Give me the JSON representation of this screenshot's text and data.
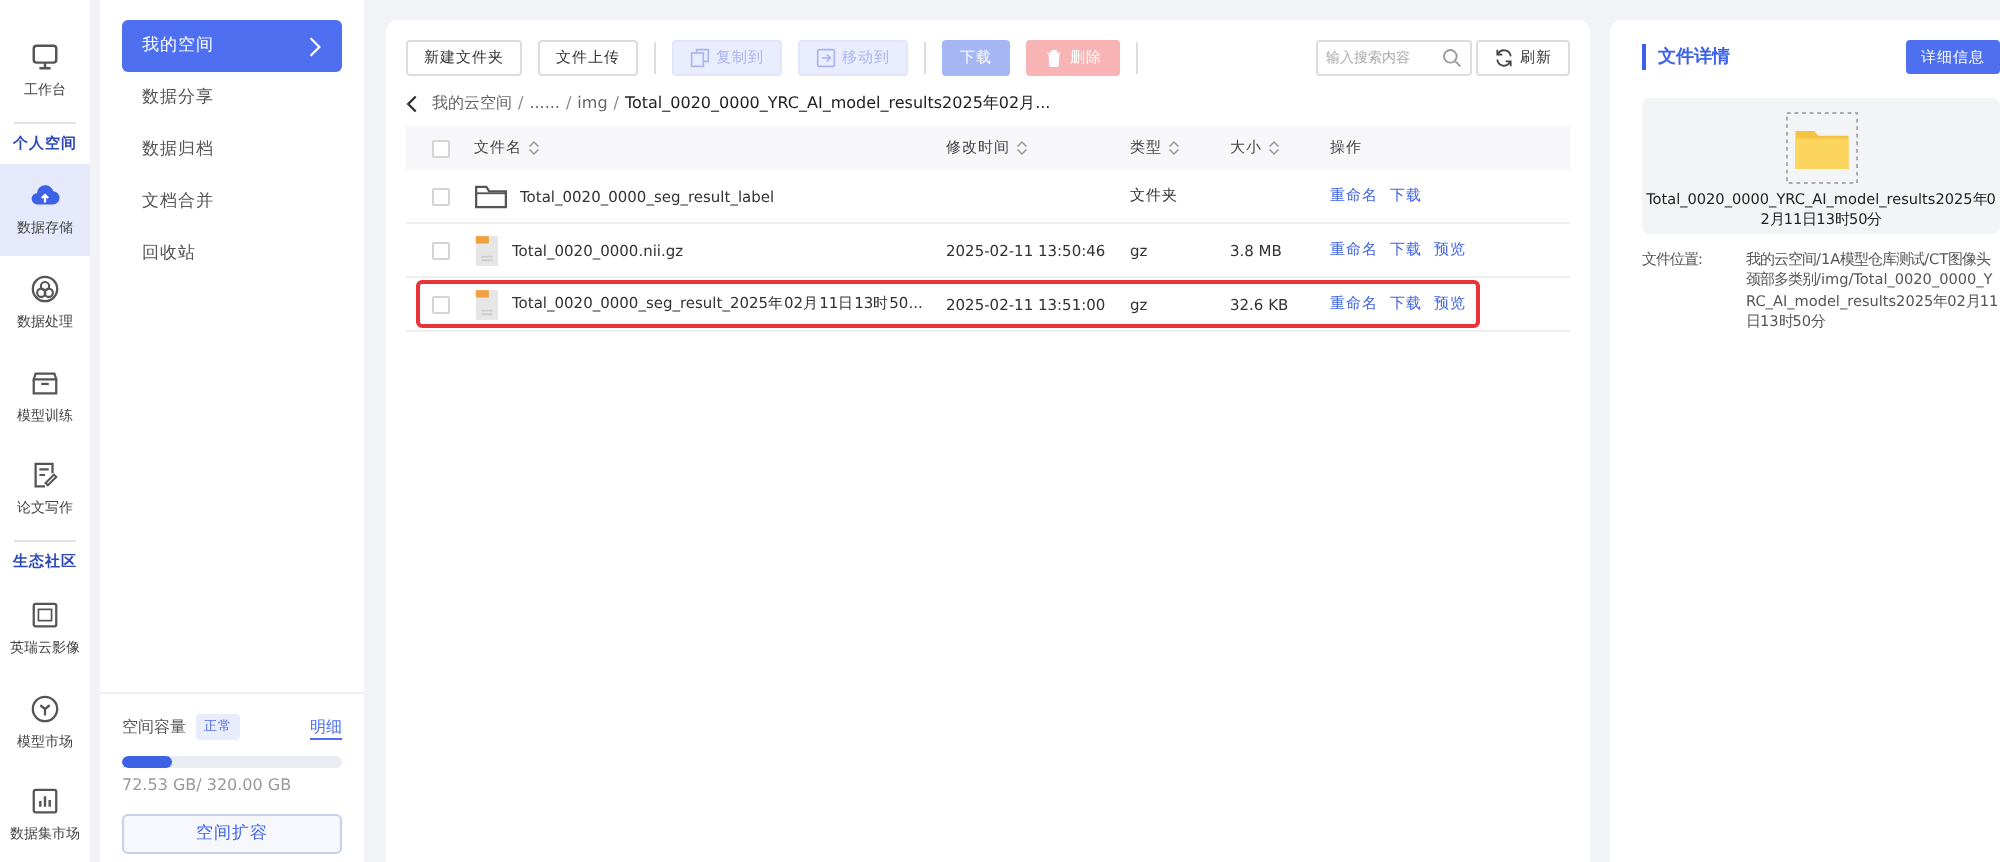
{
  "rail": {
    "top": {
      "label": "工作台",
      "selected": false
    },
    "sections": [
      {
        "title": "个人空间",
        "items": [
          {
            "label": "数据存储",
            "selected": true
          },
          {
            "label": "数据处理",
            "selected": false
          },
          {
            "label": "模型训练",
            "selected": false
          },
          {
            "label": "论文写作",
            "selected": false
          }
        ]
      },
      {
        "title": "生态社区",
        "items": [
          {
            "label": "英瑞云影像",
            "selected": false
          },
          {
            "label": "模型市场",
            "selected": false
          },
          {
            "label": "数据集市场",
            "selected": false
          }
        ]
      }
    ]
  },
  "sidebar": {
    "items": [
      {
        "label": "我的空间",
        "selected": true
      },
      {
        "label": "数据分享",
        "selected": false
      },
      {
        "label": "数据归档",
        "selected": false
      },
      {
        "label": "文档合并",
        "selected": false
      },
      {
        "label": "回收站",
        "selected": false
      }
    ],
    "capacity": {
      "label": "空间容量",
      "status": "正常",
      "detail_link": "明细",
      "level": 0.227,
      "reading": "72.53 GB/ 320.00 GB",
      "expand_button": "空间扩容"
    }
  },
  "toolbar": {
    "buttons": [
      {
        "label": "新建文件夹",
        "kind": "plain",
        "disabled": false
      },
      {
        "label": "文件上传",
        "kind": "plain",
        "disabled": false
      },
      {
        "label": "复制到",
        "kind": "copy",
        "disabled": true
      },
      {
        "label": "移动到",
        "kind": "move",
        "disabled": true
      },
      {
        "label": "下载",
        "kind": "primary",
        "disabled": true
      },
      {
        "label": "删除",
        "kind": "danger",
        "disabled": true
      }
    ],
    "search": {
      "placeholder": "输入搜索内容"
    },
    "refresh": "刷新"
  },
  "breadcrumb": {
    "separator": "/",
    "items": [
      "我的云空间",
      "......",
      "img",
      "Total_0020_0000_YRC_AI_model_results2025年02月..."
    ]
  },
  "table": {
    "select_all_checked": false,
    "columns": [
      "文件名",
      "修改时间",
      "类型",
      "大小",
      "操作"
    ],
    "rows": [
      {
        "kind": "folder",
        "name": "Total_0020_0000_seg_result_label",
        "modified": "",
        "type": "文件夹",
        "size": "",
        "checked": false,
        "highlighted": false,
        "actions": [
          "重命名",
          "下载"
        ]
      },
      {
        "kind": "file",
        "name": "Total_0020_0000.nii.gz",
        "modified": "2025-02-11 13:50:46",
        "type": "gz",
        "size": "3.8 MB",
        "checked": false,
        "highlighted": false,
        "actions": [
          "重命名",
          "下载",
          "预览"
        ]
      },
      {
        "kind": "file",
        "name": "Total_0020_0000_seg_result_2025年02月11日13时50...",
        "modified": "2025-02-11 13:51:00",
        "type": "gz",
        "size": "32.6 KB",
        "checked": false,
        "highlighted": true,
        "actions": [
          "重命名",
          "下载",
          "预览"
        ]
      }
    ]
  },
  "details": {
    "title": "文件详情",
    "button": "详细信息",
    "file_name": "Total_0020_0000_YRC_AI_model_results2025年02月11日13时50分",
    "location_label": "文件位置:",
    "location": "我的云空间/1A模型仓库测试/CT图像头颈部多类别/img/Total_0020_0000_YRC_AI_model_results2025年02月11日13时50分"
  }
}
